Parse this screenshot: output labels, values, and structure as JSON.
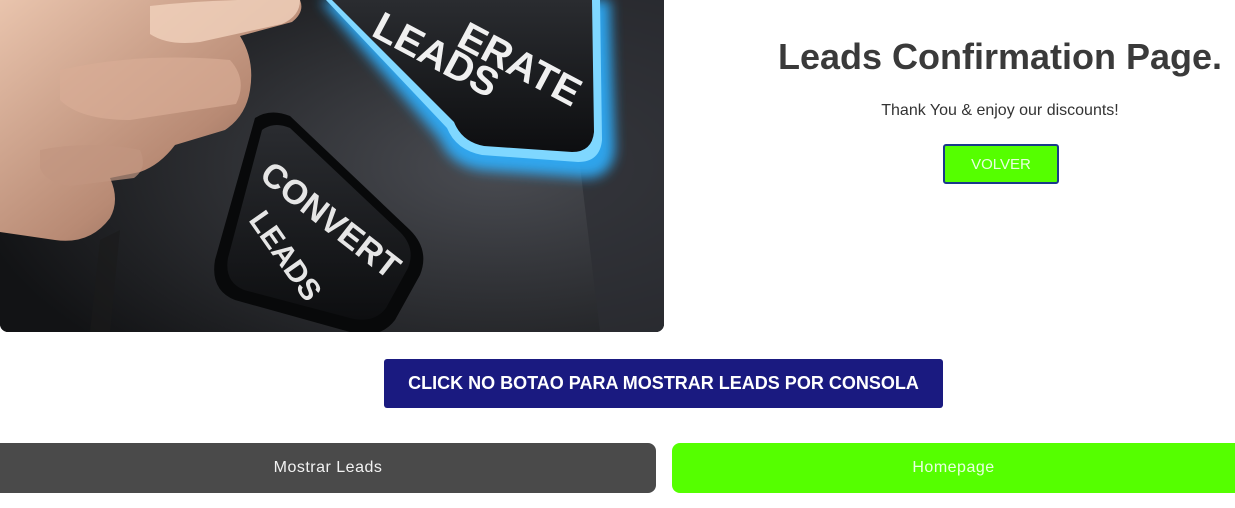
{
  "hero": {
    "alt": "hand pressing generate leads and convert leads buttons",
    "button_top_text": "ERATE LEADS",
    "button_bottom_text": "CONVERT LEADS"
  },
  "confirmation": {
    "title": "Leads Confirmation Page.",
    "message": "Thank You & enjoy our discounts!",
    "back_button": "VOLVER"
  },
  "banner": {
    "text": "CLICK NO BOTAO PARA MOSTRAR LEADS POR CONSOLA"
  },
  "actions": {
    "show_leads": "Mostrar Leads",
    "homepage": "Homepage"
  },
  "colors": {
    "green": "#55ff00",
    "navy": "#1a1a80",
    "dark_gray": "#4a4a4a",
    "title_text": "#3a3a3a"
  }
}
